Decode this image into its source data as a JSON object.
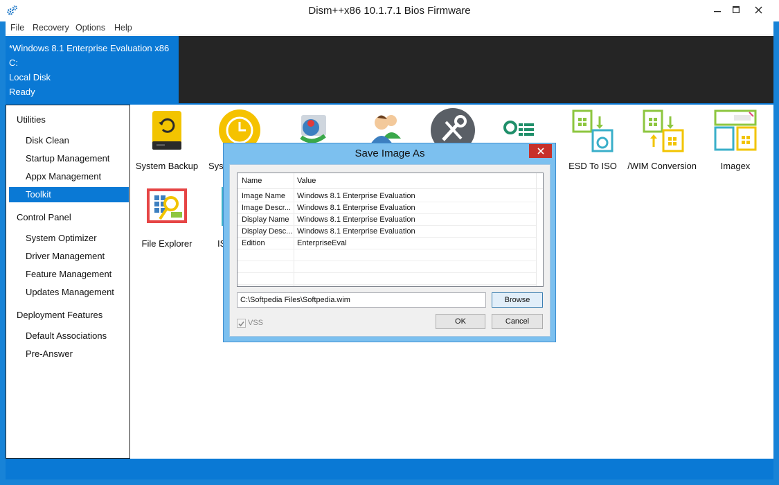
{
  "window": {
    "title": "Dism++x86 10.1.7.1 Bios Firmware"
  },
  "menu": [
    "File",
    "Recovery",
    "Options",
    "Help"
  ],
  "info": {
    "line1": "*Windows 8.1 Enterprise Evaluation x86",
    "line2": "C:",
    "line3": "Local Disk",
    "line4": "Ready"
  },
  "sidebar": {
    "sections": [
      {
        "label": "Utilities",
        "items": [
          "Disk Clean",
          "Startup Management",
          "Appx Management",
          "Toolkit"
        ]
      },
      {
        "label": "Control Panel",
        "items": [
          "System Optimizer",
          "Driver Management",
          "Feature Management",
          "Updates Management"
        ]
      },
      {
        "label": "Deployment Features",
        "items": [
          "Default Associations",
          "Pre-Answer"
        ]
      }
    ],
    "active": "Toolkit"
  },
  "tools": [
    {
      "label": "System Backup",
      "icon": "backup-drive-icon"
    },
    {
      "label": "System",
      "icon": "restore-clock-icon"
    },
    {
      "label": "",
      "icon": "network-account-icon"
    },
    {
      "label": "",
      "icon": "users-icon"
    },
    {
      "label": "",
      "icon": "tools-icon"
    },
    {
      "label": "",
      "icon": "settings-list-icon"
    },
    {
      "label": "ESD To ISO",
      "icon": "esd-to-iso-icon"
    },
    {
      "label": "ESD/WIM Conversion",
      "icon": "esd-wim-convert-icon"
    },
    {
      "label": "Imagex",
      "icon": "imagex-icon"
    },
    {
      "label": "File Explorer",
      "icon": "file-explorer-icon"
    },
    {
      "label": "IS",
      "icon": "iso-icon"
    }
  ],
  "dialog": {
    "title": "Save Image As",
    "columns": [
      "Name",
      "Value"
    ],
    "rows": [
      {
        "name": "Image Name",
        "value": "Windows 8.1 Enterprise Evaluation"
      },
      {
        "name": "Image Descr...",
        "value": "Windows 8.1 Enterprise Evaluation"
      },
      {
        "name": "Display Name",
        "value": "Windows 8.1 Enterprise Evaluation"
      },
      {
        "name": "Display Desc...",
        "value": "Windows 8.1 Enterprise Evaluation"
      },
      {
        "name": "Edition",
        "value": "EnterpriseEval"
      },
      {
        "name": "",
        "value": ""
      },
      {
        "name": "",
        "value": ""
      },
      {
        "name": "",
        "value": ""
      }
    ],
    "path": "C:\\Softpedia Files\\Softpedia.wim",
    "browse_label": "Browse",
    "ok_label": "OK",
    "cancel_label": "Cancel",
    "vss_label": "VSS",
    "vss_checked": true
  },
  "colors": {
    "accent": "#0a79d5",
    "dark_panel": "#252525",
    "dialog_frame": "#7cc0ef",
    "close_red": "#c7312b"
  }
}
